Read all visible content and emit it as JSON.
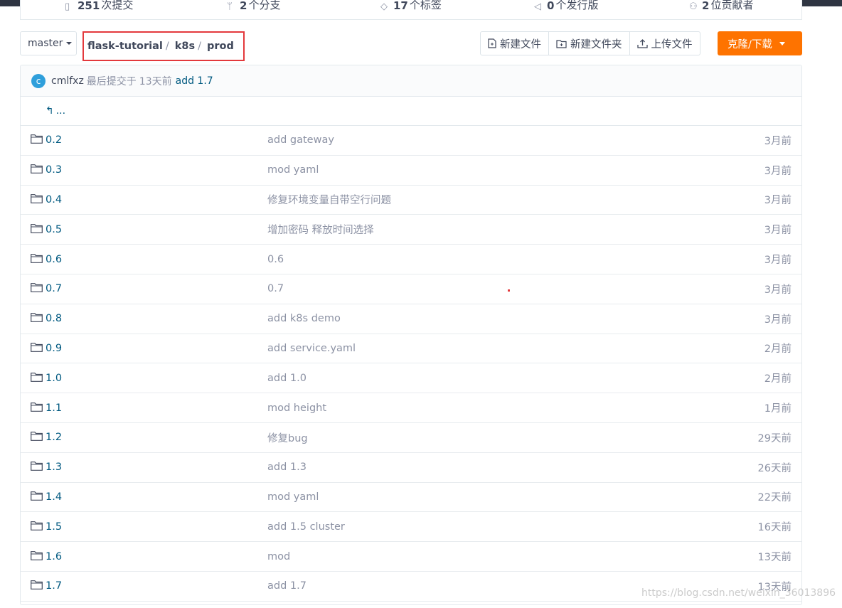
{
  "colors": {
    "accent": "#fe7300",
    "link": "#005980",
    "highlight_border": "#e3393c",
    "avatar": "#2f9fdb"
  },
  "stats": [
    {
      "icon": "commit-icon",
      "count": "251",
      "label": "次提交"
    },
    {
      "icon": "branch-icon",
      "count": "2",
      "label": "个分支"
    },
    {
      "icon": "tag-icon",
      "count": "17",
      "label": "个标签"
    },
    {
      "icon": "release-icon",
      "count": "0",
      "label": "个发行版"
    },
    {
      "icon": "contributors-icon",
      "count": "2",
      "label": "位贡献者"
    }
  ],
  "branch": {
    "label": "master"
  },
  "breadcrumb": {
    "repo": "flask-tutorial",
    "sep1": "/",
    "dir1": "k8s",
    "sep2": "/",
    "dir2": "prod"
  },
  "toolbar": {
    "new_file": "新建文件",
    "new_folder": "新建文件夹",
    "upload": "上传文件",
    "clone": "克隆/下载"
  },
  "last_commit": {
    "avatar_letter": "c",
    "author": "cmlfxz",
    "label": "最后提交于",
    "time": "13天前",
    "message": "add 1.7"
  },
  "parent_dir": {
    "label": "..."
  },
  "files": [
    {
      "name": "0.2",
      "message": "add gateway",
      "time": "3月前"
    },
    {
      "name": "0.3",
      "message": "mod yaml",
      "time": "3月前"
    },
    {
      "name": "0.4",
      "message": "修复环境变量自带空行问题",
      "time": "3月前"
    },
    {
      "name": "0.5",
      "message": "增加密码 释放时间选择",
      "time": "3月前"
    },
    {
      "name": "0.6",
      "message": "0.6",
      "time": "3月前"
    },
    {
      "name": "0.7",
      "message": "0.7",
      "time": "3月前"
    },
    {
      "name": "0.8",
      "message": "add k8s demo",
      "time": "3月前"
    },
    {
      "name": "0.9",
      "message": "add service.yaml",
      "time": "2月前"
    },
    {
      "name": "1.0",
      "message": "add 1.0",
      "time": "2月前"
    },
    {
      "name": "1.1",
      "message": "mod height",
      "time": "1月前"
    },
    {
      "name": "1.2",
      "message": "修复bug",
      "time": "29天前"
    },
    {
      "name": "1.3",
      "message": "add 1.3",
      "time": "26天前"
    },
    {
      "name": "1.4",
      "message": "mod yaml",
      "time": "22天前"
    },
    {
      "name": "1.5",
      "message": "add 1.5 cluster",
      "time": "16天前"
    },
    {
      "name": "1.6",
      "message": "mod",
      "time": "13天前"
    },
    {
      "name": "1.7",
      "message": "add 1.7",
      "time": "13天前"
    }
  ],
  "watermark": "https://blog.csdn.net/weixin_36013896"
}
